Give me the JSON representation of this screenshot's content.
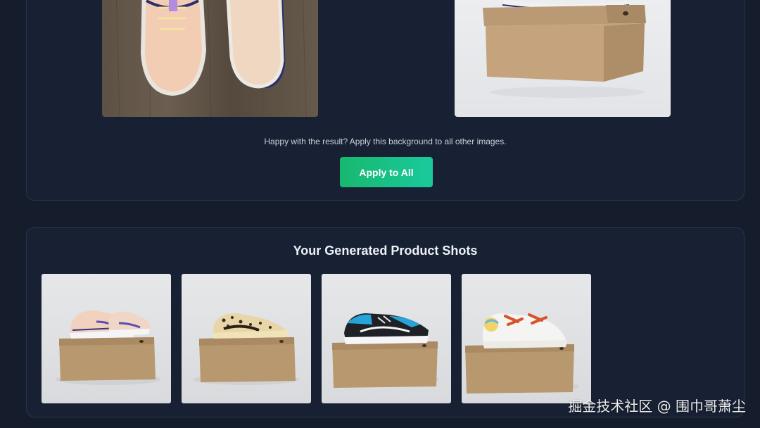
{
  "top_section": {
    "hint_text": "Happy with the result? Apply this background to all other images.",
    "apply_button_label": "Apply to All"
  },
  "gallery": {
    "title": "Your Generated Product Shots",
    "items": [
      {
        "shoe": "peach-purple-running-shoe"
      },
      {
        "shoe": "leopard-print-sneaker"
      },
      {
        "shoe": "black-blue-running-shoe"
      },
      {
        "shoe": "white-orange-lace-sneaker"
      }
    ]
  },
  "watermark": "掘金技术社区 @ 围巾哥萧尘",
  "colors": {
    "background": "#151c2c",
    "card": "#182134",
    "accent_start": "#17b86f",
    "accent_end": "#1ac99c"
  }
}
